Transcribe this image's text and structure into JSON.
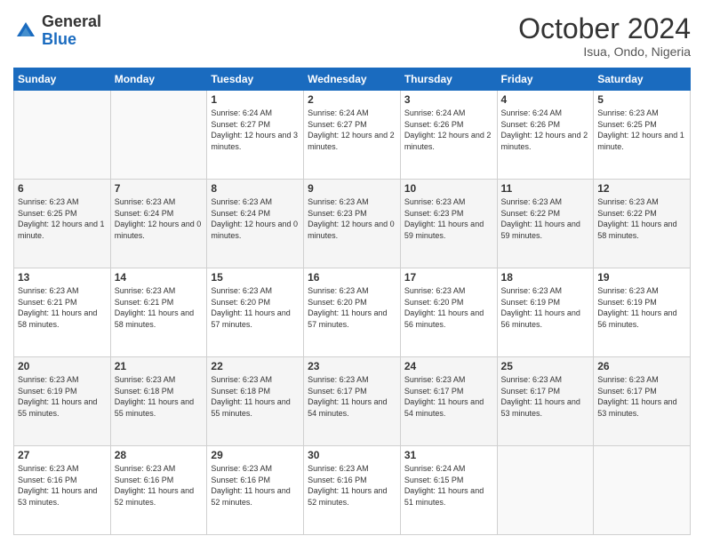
{
  "header": {
    "logo_general": "General",
    "logo_blue": "Blue",
    "month_title": "October 2024",
    "location": "Isua, Ondo, Nigeria"
  },
  "days_of_week": [
    "Sunday",
    "Monday",
    "Tuesday",
    "Wednesday",
    "Thursday",
    "Friday",
    "Saturday"
  ],
  "weeks": [
    [
      {
        "day": "",
        "info": ""
      },
      {
        "day": "",
        "info": ""
      },
      {
        "day": "1",
        "info": "Sunrise: 6:24 AM\nSunset: 6:27 PM\nDaylight: 12 hours and 3 minutes."
      },
      {
        "day": "2",
        "info": "Sunrise: 6:24 AM\nSunset: 6:27 PM\nDaylight: 12 hours and 2 minutes."
      },
      {
        "day": "3",
        "info": "Sunrise: 6:24 AM\nSunset: 6:26 PM\nDaylight: 12 hours and 2 minutes."
      },
      {
        "day": "4",
        "info": "Sunrise: 6:24 AM\nSunset: 6:26 PM\nDaylight: 12 hours and 2 minutes."
      },
      {
        "day": "5",
        "info": "Sunrise: 6:23 AM\nSunset: 6:25 PM\nDaylight: 12 hours and 1 minute."
      }
    ],
    [
      {
        "day": "6",
        "info": "Sunrise: 6:23 AM\nSunset: 6:25 PM\nDaylight: 12 hours and 1 minute."
      },
      {
        "day": "7",
        "info": "Sunrise: 6:23 AM\nSunset: 6:24 PM\nDaylight: 12 hours and 0 minutes."
      },
      {
        "day": "8",
        "info": "Sunrise: 6:23 AM\nSunset: 6:24 PM\nDaylight: 12 hours and 0 minutes."
      },
      {
        "day": "9",
        "info": "Sunrise: 6:23 AM\nSunset: 6:23 PM\nDaylight: 12 hours and 0 minutes."
      },
      {
        "day": "10",
        "info": "Sunrise: 6:23 AM\nSunset: 6:23 PM\nDaylight: 11 hours and 59 minutes."
      },
      {
        "day": "11",
        "info": "Sunrise: 6:23 AM\nSunset: 6:22 PM\nDaylight: 11 hours and 59 minutes."
      },
      {
        "day": "12",
        "info": "Sunrise: 6:23 AM\nSunset: 6:22 PM\nDaylight: 11 hours and 58 minutes."
      }
    ],
    [
      {
        "day": "13",
        "info": "Sunrise: 6:23 AM\nSunset: 6:21 PM\nDaylight: 11 hours and 58 minutes."
      },
      {
        "day": "14",
        "info": "Sunrise: 6:23 AM\nSunset: 6:21 PM\nDaylight: 11 hours and 58 minutes."
      },
      {
        "day": "15",
        "info": "Sunrise: 6:23 AM\nSunset: 6:20 PM\nDaylight: 11 hours and 57 minutes."
      },
      {
        "day": "16",
        "info": "Sunrise: 6:23 AM\nSunset: 6:20 PM\nDaylight: 11 hours and 57 minutes."
      },
      {
        "day": "17",
        "info": "Sunrise: 6:23 AM\nSunset: 6:20 PM\nDaylight: 11 hours and 56 minutes."
      },
      {
        "day": "18",
        "info": "Sunrise: 6:23 AM\nSunset: 6:19 PM\nDaylight: 11 hours and 56 minutes."
      },
      {
        "day": "19",
        "info": "Sunrise: 6:23 AM\nSunset: 6:19 PM\nDaylight: 11 hours and 56 minutes."
      }
    ],
    [
      {
        "day": "20",
        "info": "Sunrise: 6:23 AM\nSunset: 6:19 PM\nDaylight: 11 hours and 55 minutes."
      },
      {
        "day": "21",
        "info": "Sunrise: 6:23 AM\nSunset: 6:18 PM\nDaylight: 11 hours and 55 minutes."
      },
      {
        "day": "22",
        "info": "Sunrise: 6:23 AM\nSunset: 6:18 PM\nDaylight: 11 hours and 55 minutes."
      },
      {
        "day": "23",
        "info": "Sunrise: 6:23 AM\nSunset: 6:17 PM\nDaylight: 11 hours and 54 minutes."
      },
      {
        "day": "24",
        "info": "Sunrise: 6:23 AM\nSunset: 6:17 PM\nDaylight: 11 hours and 54 minutes."
      },
      {
        "day": "25",
        "info": "Sunrise: 6:23 AM\nSunset: 6:17 PM\nDaylight: 11 hours and 53 minutes."
      },
      {
        "day": "26",
        "info": "Sunrise: 6:23 AM\nSunset: 6:17 PM\nDaylight: 11 hours and 53 minutes."
      }
    ],
    [
      {
        "day": "27",
        "info": "Sunrise: 6:23 AM\nSunset: 6:16 PM\nDaylight: 11 hours and 53 minutes."
      },
      {
        "day": "28",
        "info": "Sunrise: 6:23 AM\nSunset: 6:16 PM\nDaylight: 11 hours and 52 minutes."
      },
      {
        "day": "29",
        "info": "Sunrise: 6:23 AM\nSunset: 6:16 PM\nDaylight: 11 hours and 52 minutes."
      },
      {
        "day": "30",
        "info": "Sunrise: 6:23 AM\nSunset: 6:16 PM\nDaylight: 11 hours and 52 minutes."
      },
      {
        "day": "31",
        "info": "Sunrise: 6:24 AM\nSunset: 6:15 PM\nDaylight: 11 hours and 51 minutes."
      },
      {
        "day": "",
        "info": ""
      },
      {
        "day": "",
        "info": ""
      }
    ]
  ]
}
